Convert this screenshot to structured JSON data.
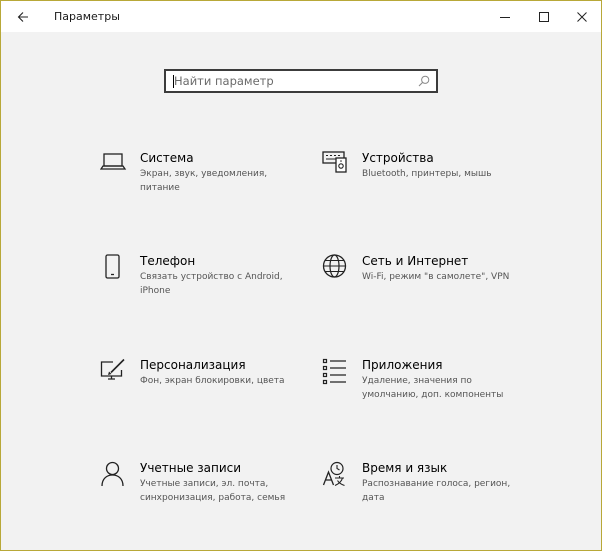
{
  "window": {
    "title": "Параметры",
    "back_icon": "arrow-left-icon",
    "minimize_icon": "minimize-icon",
    "maximize_icon": "maximize-icon",
    "close_icon": "close-icon"
  },
  "search": {
    "placeholder": "Найти параметр",
    "value": "",
    "icon": "search-icon"
  },
  "categories": [
    {
      "icon": "laptop-icon",
      "name": "Система",
      "description": "Экран, звук, уведомления, питание"
    },
    {
      "icon": "devices-icon",
      "name": "Устройства",
      "description": "Bluetooth, принтеры, мышь"
    },
    {
      "icon": "phone-icon",
      "name": "Телефон",
      "description": "Связать устройство с Android, iPhone"
    },
    {
      "icon": "globe-icon",
      "name": "Сеть и Интернет",
      "description": "Wi-Fi, режим \"в самолете\", VPN"
    },
    {
      "icon": "personalization-icon",
      "name": "Персонализация",
      "description": "Фон, экран блокировки, цвета"
    },
    {
      "icon": "apps-icon",
      "name": "Приложения",
      "description": "Удаление, значения по умолчанию, доп. компоненты"
    },
    {
      "icon": "person-icon",
      "name": "Учетные записи",
      "description": "Учетные записи, эл. почта, синхронизация, работа, семья"
    },
    {
      "icon": "time-language-icon",
      "name": "Время и язык",
      "description": "Распознавание голоса, регион, дата"
    }
  ]
}
